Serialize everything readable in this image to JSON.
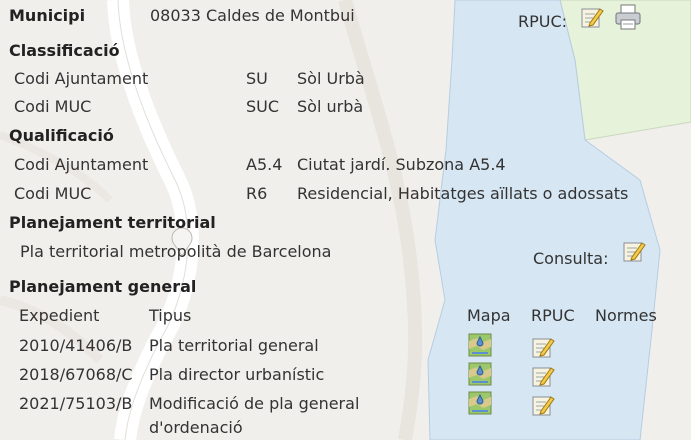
{
  "header": {
    "municipi_label": "Municipi",
    "municipi_value": "08033 Caldes de Montbui",
    "rpuc_label": "RPUC:"
  },
  "classificacio": {
    "title": "Classificació",
    "rows": [
      {
        "label": "Codi Ajuntament",
        "code": "SU",
        "desc": "Sòl Urbà"
      },
      {
        "label": "Codi MUC",
        "code": "SUC",
        "desc": "Sòl urbà"
      }
    ]
  },
  "qualificacio": {
    "title": "Qualificació",
    "rows": [
      {
        "label": "Codi Ajuntament",
        "code": "A5.4",
        "desc": "Ciutat jardí. Subzona A5.4"
      },
      {
        "label": "Codi MUC",
        "code": "R6",
        "desc": "Residencial, Habitatges aïllats o adossats"
      }
    ]
  },
  "territorial": {
    "title": "Planejament territorial",
    "plan": "Pla territorial metropolità de Barcelona",
    "consulta_label": "Consulta:"
  },
  "general": {
    "title": "Planejament general",
    "columns": {
      "expedient": "Expedient",
      "tipus": "Tipus",
      "mapa": "Mapa",
      "rpuc": "RPUC",
      "normes": "Normes"
    },
    "rows": [
      {
        "expedient": "2010/41406/B",
        "tipus": "Pla territorial general",
        "tipus2": ""
      },
      {
        "expedient": "2018/67068/C",
        "tipus": "Pla director urbanístic",
        "tipus2": ""
      },
      {
        "expedient": "2021/75103/B",
        "tipus": "Modificació de pla general",
        "tipus2": "d'ordenació"
      }
    ]
  },
  "icons": {
    "edit": "edit-document-icon",
    "print": "printer-icon",
    "map": "map-icon"
  },
  "colors": {
    "water": "#d6e6f3",
    "park": "#e6f2da",
    "road": "#ffffff",
    "land": "#f1efec"
  }
}
